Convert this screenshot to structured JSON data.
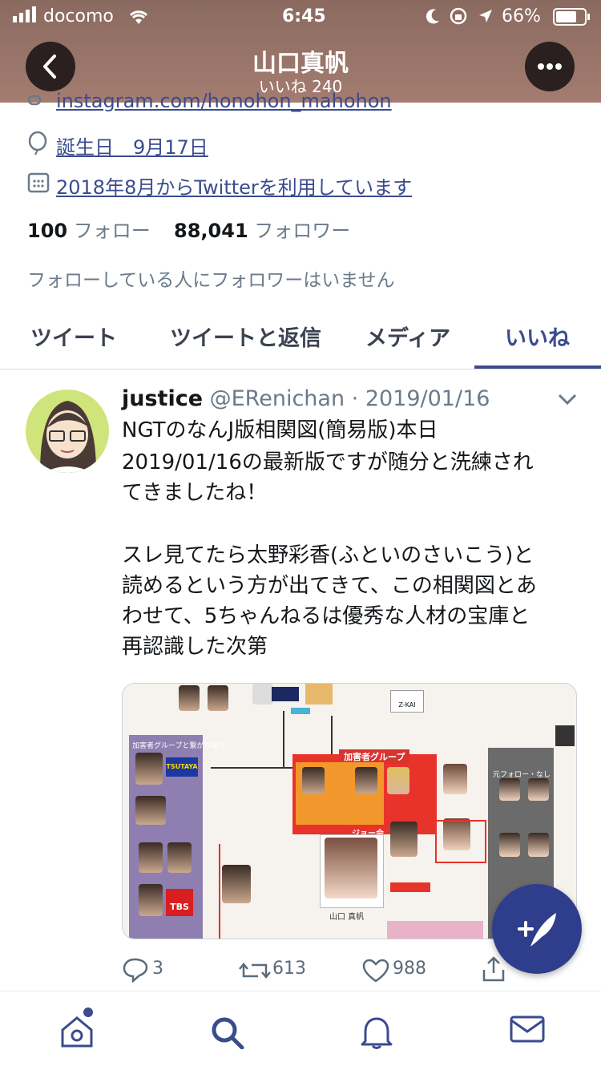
{
  "status_bar": {
    "carrier": "docomo",
    "time": "6:45",
    "battery": "66%"
  },
  "header": {
    "title": "山口真帆",
    "subtitle": "いいね 240"
  },
  "profile": {
    "link_partial": "instagram.com/honohon_mahohon",
    "birthday": "誕生日　9月17日",
    "joined": "2018年8月からTwitterを利用しています",
    "following_count": "100",
    "following_label": "フォロー",
    "followers_count": "88,041",
    "followers_label": "フォロワー",
    "followers_you_know": "フォローしている人にフォロワーはいません"
  },
  "tabs": [
    {
      "label": "ツイート",
      "active": false
    },
    {
      "label": "ツイートと返信",
      "active": false
    },
    {
      "label": "メディア",
      "active": false
    },
    {
      "label": "いいね",
      "active": true
    }
  ],
  "tweet": {
    "name": "justice",
    "meta": "@ERenichan · 2019/01/16",
    "lines": [
      "NGTのなんJ版相関図(簡易版)本日",
      "2019/01/16の最新版ですが随分と洗練され",
      "てきましたね！",
      "",
      "スレ見てたら太野彩香(ふといのさいこう)と",
      "読めるという方が出てきて、この相関図とあ",
      "わせて、5ちゃんねるは優秀な人材の宝庫と",
      "再認識した次第"
    ],
    "image_labels": {
      "z_kai": "Z-KAI",
      "group": "加害者グループ",
      "tsutaya": "TSUTAYA",
      "tbs": "TBS",
      "victim": "山口 真帆",
      "joe": "ジョー会",
      "left_panel": "加害者グループと繋がりあり",
      "right_panel": "元フォロー・なし"
    },
    "replies": "3",
    "retweets": "613",
    "likes": "988"
  },
  "colors": {
    "accent": "#3b4b8e",
    "fab": "#2e3e8c",
    "tab_active": "#3b4b8e",
    "muted": "#6b7a8a"
  },
  "icons": {
    "back": "chevron-left-icon",
    "more": "more-icon",
    "link": "link-icon",
    "birthday": "balloon-icon",
    "calendar": "calendar-icon",
    "caret": "chevron-down-icon",
    "reply": "reply-icon",
    "retweet": "retweet-icon",
    "like": "heart-icon",
    "share": "share-icon",
    "compose": "compose-icon",
    "home": "home-icon",
    "search": "search-icon",
    "notifications": "bell-icon",
    "messages": "mail-icon"
  }
}
